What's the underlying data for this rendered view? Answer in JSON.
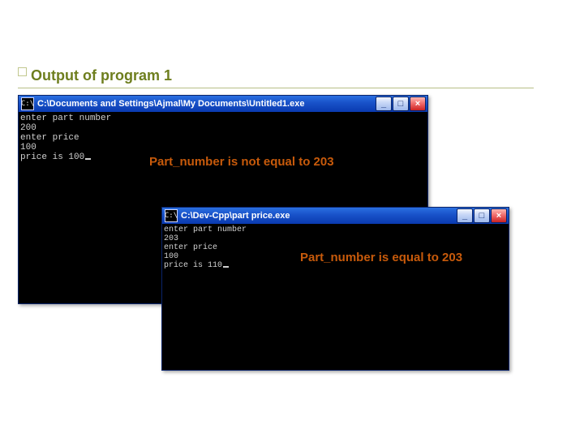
{
  "slide": {
    "title": "Output of program 1"
  },
  "win1": {
    "sysicon_label": "C:\\",
    "title": "C:\\Documents and Settings\\Ajmal\\My Documents\\Untitled1.exe",
    "btn_min": "_",
    "btn_max": "□",
    "btn_close": "×",
    "lines": {
      "l1": "enter part number",
      "l2": "200",
      "l3": "enter price",
      "l4": "100",
      "l5": "price is 100"
    },
    "annotation": "Part_number is not equal to 203"
  },
  "win2": {
    "sysicon_label": "C:\\",
    "title": "C:\\Dev-Cpp\\part price.exe",
    "btn_min": "_",
    "btn_max": "□",
    "btn_close": "×",
    "lines": {
      "l1": "enter part number",
      "l2": "203",
      "l3": "enter price",
      "l4": "100",
      "l5": "price is 110"
    },
    "annotation": "Part_number is equal to 203"
  }
}
